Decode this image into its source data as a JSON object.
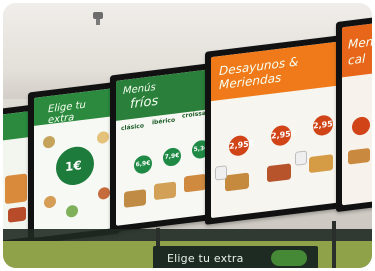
{
  "panels": {
    "left_partial": {
      "title": ""
    },
    "elige": {
      "title": "Elige tu extra",
      "price": "1€"
    },
    "menus_frios": {
      "title_line1": "Menús",
      "title_line2": "fríos",
      "columns": [
        "clásico",
        "ibérico",
        "croissant"
      ],
      "prices": [
        "6,9€",
        "7,9€",
        "5,3€"
      ]
    },
    "desayunos": {
      "title_line1": "Desayunos &",
      "title_line2": "Meriendas",
      "prices": [
        "2,95€",
        "2,95€",
        "2,95€"
      ]
    },
    "right_partial": {
      "title_line1": "Menú",
      "title_line2": "cal"
    }
  },
  "bottom_sign": {
    "text": "Elige tu extra"
  },
  "colors": {
    "green": "#2b8a3e",
    "orange": "#f07a19",
    "price_red": "#d04417"
  }
}
